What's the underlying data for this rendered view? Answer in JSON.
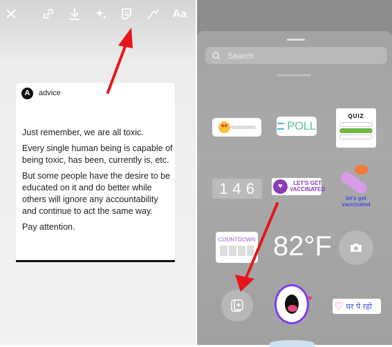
{
  "left_panel": {
    "toolbar": [
      {
        "icon": "close-icon"
      },
      {
        "icon": "link-icon"
      },
      {
        "icon": "download-icon"
      },
      {
        "icon": "effects-sparkle-icon"
      },
      {
        "icon": "sticker-icon"
      },
      {
        "icon": "draw-icon"
      },
      {
        "icon": "text-icon",
        "label": "Aa"
      }
    ],
    "post": {
      "avatar_letter": "A",
      "author": "advice",
      "paragraphs": [
        "Just remember, we are all toxic.",
        "Every single human being is capable of being toxic, has been, currently is, etc.",
        "But some people have the desire to be educated on it and do better while others will ignore any accountability and continue to act the same way.",
        "Pay attention."
      ]
    }
  },
  "right_panel": {
    "search": {
      "placeholder": "Search"
    },
    "stickers": {
      "poll": "POLL",
      "quiz": "QUIZ",
      "countdown_digits": "146",
      "vaccinated_1": [
        "LET'S GET",
        "VACCINATED"
      ],
      "vaccinated_2": [
        "let's get",
        "vaccinated"
      ],
      "countdown": "COUNTDOWN",
      "temperature": "82°F",
      "stay_home": "घर पे रहो"
    }
  },
  "colors": {
    "arrow": "#e8141b",
    "poll_green": "#6cc04a",
    "quiz_green": "#6cb844",
    "vaccine_purple": "#8a3bb7"
  }
}
